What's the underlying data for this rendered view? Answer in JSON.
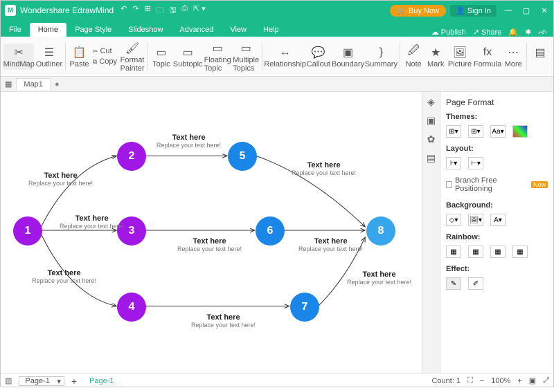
{
  "app": {
    "title": "Wondershare EdrawMind"
  },
  "titlebar": {
    "buy": "Buy Now",
    "signin": "Sign In"
  },
  "menu": {
    "tabs": [
      "File",
      "Home",
      "Page Style",
      "Slideshow",
      "Advanced",
      "View",
      "Help"
    ],
    "active": 1,
    "publish": "Publish",
    "share": "Share"
  },
  "ribbon": {
    "mindmap": "MindMap",
    "outliner": "Outliner",
    "paste": "Paste",
    "cut": "Cut",
    "copy": "Copy",
    "format_painter": "Format\nPainter",
    "topic": "Topic",
    "subtopic": "Subtopic",
    "floating": "Floating\nTopic",
    "multiple": "Multiple\nTopics",
    "relationship": "Relationship",
    "callout": "Callout",
    "boundary": "Boundary",
    "summary": "Summary",
    "note": "Note",
    "mark": "Mark",
    "picture": "Picture",
    "formula": "Formula",
    "more": "More"
  },
  "doctab": {
    "name": "Map1"
  },
  "nodes": {
    "n1": "1",
    "n2": "2",
    "n3": "3",
    "n4": "4",
    "n5": "5",
    "n6": "6",
    "n7": "7",
    "n8": "8"
  },
  "label": {
    "title": "Text here",
    "sub": "Replace your text here!"
  },
  "panel": {
    "title": "Page Format",
    "themes": "Themes:",
    "layout": "Layout:",
    "branch": "Branch Free Positioning",
    "new": "New",
    "background": "Background:",
    "rainbow": "Rainbow:",
    "effect": "Effect:"
  },
  "status": {
    "page_sel": "Page-1",
    "page_tab": "Page-1",
    "count": "Count: 1",
    "zoom": "100%"
  }
}
